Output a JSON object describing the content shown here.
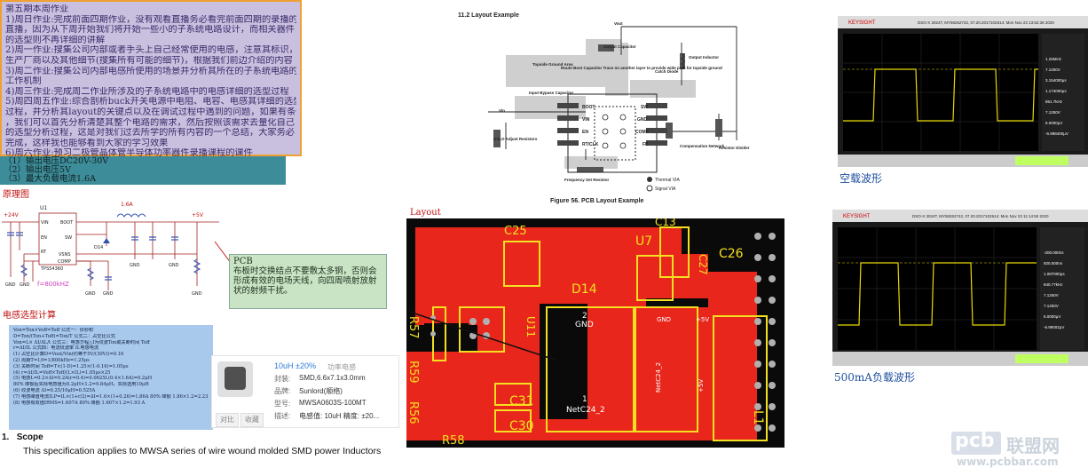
{
  "homework": {
    "lines": [
      "第五期本周作业",
      "1)周日作业:完成前面四期作业，没有观看直播务必看完前面四期的录播的",
      "直播，因为从下周开始我们将开始一些小的子系统电路设计，而相关器件",
      "的选型则不再详细的讲解",
      "2)周一作业:搜集公司内部或者手头上自己经常使用的电感，注意其标识，",
      "生产厂商以及其他细节(搜集所有可能的细节)，根据我们前边介绍的内容",
      "3)周二作业:搜集公司内部电感所使用的场景并分析其所在的子系统电路的",
      "工作机制",
      "4)周三作业:完成周二作业所涉及的子系统电路中的电感详细的选型过程",
      "5)周四周五作业:综合剖析buck开关电源中电阻、电容、电感其详细的选型",
      "过程，并分析其layout的关键点以及在调试过程中遇到的问题，如果有条件",
      "，我们可以首先分析清楚其整个电路的需求，然后按照该需求去量化自己",
      "的选型分析过程，这是对我们过去所学的所有内容的一个总结，大家务必",
      "完成，这样我也能够看到大家的学习效果",
      "6)周六作业:预习二极管晶体管半导体功率器件录播课程的课件"
    ]
  },
  "specs": {
    "lines": [
      "（1）输出电压DC20V-30V",
      "（2）输出电压5V",
      "（3）最大负载电流1.6A"
    ]
  },
  "labels": {
    "schematic_title": "原理图",
    "inductor_calc_title": "电感选型计算",
    "layout_title": "Layout"
  },
  "schematic": {
    "current": "1.6A",
    "vin": "+24V",
    "vout": "+5V",
    "chip": "U1",
    "chip_part": "TPS54360",
    "freq": "f=800kHZ",
    "diode": "D14",
    "pin_vin": "VIN",
    "pin_en": "EN",
    "pin_boot": "BOOT",
    "pin_sw": "SW",
    "pin_rt": "RT",
    "pin_comp": "COMP",
    "pin_vsns": "VSNS",
    "gnd": "GND"
  },
  "pcb_note": {
    "title": "PCB",
    "body": [
      "布板时交换结点不要敷太多铜，否则会",
      "形成有效的电场天线，向四周喷射放射",
      "状的射频干扰。"
    ]
  },
  "formula": {
    "lines": [
      "Von=Ton×Voff=Toff        公式一：伏秒积",
      "D=Ton/(Ton+Toff)=Ton/T    公式二：占空比公式",
      "Von=L× ΔI/ΔL/t             公式三：电感方程△I为纹波Ton或关断时间 Toff",
      "r=ΔI/IL                        公式四：电流纹波率 IL电感电流",
      "(1) 占空比计算D=Vout/Vin(约等于5V/(30V))=0.16",
      "(2) 周期T=1/f=1/800kHz=1.25μs",
      "(3) 关断时间 Toff=T×(1-D)=1.25×(1-0.16)=1.05μs",
      "(4) r=ΔI/IL=Voff×Toff/(L×IL)=1.05μs×25",
      "(5) 电感L=0.2×ΔI=0.2A(r=0.4)=0.0625L(0.4×1.6A)=0.2μH",
      "    80% 降额后实际电感值为8.2μH×1.2=9.84μH，实际选用10μH",
      "(6) 纹波电流 ΔI=0.25/10μH=0.525A",
      "(7) 电感峰值电流ILP=IL×(1+r/2)=ΔI=1.6×(1+0.26)=1.86A    80% 降额 1.86×1.2=2.23 A",
      "(8) 电感有效值IRMS=1.607A    80% 降额 1.607×1.2=1.93 A"
    ]
  },
  "product": {
    "title": "10uH ±20%",
    "tag": "功率电感",
    "rows": [
      {
        "key": "封装:",
        "val": "SMD,6.6x7.1x3.0mm"
      },
      {
        "key": "品牌:",
        "val": "Sunlord(顺络)"
      },
      {
        "key": "型号:",
        "val": "MWSA0603S-100MT"
      },
      {
        "key": "描述:",
        "val": "电感值: 10uH 精度: ±20..."
      }
    ],
    "compare": "对比",
    "favorite": "收藏"
  },
  "scope_section": {
    "number": "1.",
    "title": "Scope",
    "text": "This specification applies to MWSA series of wire wound molded SMD power Inductors"
  },
  "layout_example": {
    "heading": "11.2  Layout Example",
    "caption": "Figure 56.  PCB Layout Example",
    "vout": "Vout",
    "output_capacitor": "Output Capacitor",
    "topside_ground": "Topside Ground Area",
    "route_boot": "Route Boot Capacitor Trace on another layer to provide wide path for topside ground",
    "output_inductor": "Output Inductor",
    "catch_diode": "Catch Diode",
    "input_bypass": "Input Bypass Capacitor",
    "vin": "Vin",
    "uvlo": "UVLO Adjust Resistors",
    "freq_set": "Frequency Set Resistor",
    "compensation": "Compensation Network",
    "resistor_divider": "Resistor Divider",
    "thermal_via": "Thermal VIA",
    "signal_via": "Signal VIA",
    "pins_left": [
      "BOOT",
      "VIN",
      "EN",
      "RT/CLK"
    ],
    "pins_right": [
      "SW",
      "GND",
      "COMP",
      "FB"
    ]
  },
  "pcb": {
    "labels": [
      "C25",
      "C13",
      "C27",
      "C26",
      "U7",
      "D14",
      "U11",
      "R57",
      "R59",
      "R56",
      "R58",
      "C31",
      "C30",
      "L1"
    ],
    "pad_gnd_num": "2",
    "pad_gnd": "GND",
    "pad_net_num": "1",
    "pad_net": "NetC24_2",
    "pad_5v": "+5V"
  },
  "scope1": {
    "brand": "KEYSIGHT",
    "model": "DSO-X 3024T, MY58262742, 07.20.2017102614: Mon Nov 23 13:52:36 2020",
    "caption": "空载波形",
    "readouts": [
      "1.25MHz",
      "7.1250V",
      "3.154000μs",
      "1.174000μs",
      "851.7kHz",
      "7.1250V",
      "6.0000μV",
      "-6.998400μV"
    ]
  },
  "scope2": {
    "brand": "KEYSIGHT",
    "model": "DSO-X 3024T, MY58262742, 07.20.2017102614: Mon Nov 23 11:14:50 2020",
    "caption": "500mA负载波形",
    "readouts": [
      "-200.000ns",
      "920.000ns",
      "1.087000μs",
      "940.77kHz",
      "7.1250V",
      "7.1250V",
      "6.0000μV",
      "-6.99002μV"
    ]
  },
  "watermark": {
    "brand": "pcb",
    "name": "联盟网",
    "url": "www.pcbbar.com"
  },
  "colors": {
    "homework_bg": "#c8c0de",
    "homework_border": "#f0a030",
    "spec_bg": "#3d8c99",
    "pcb_red": "#e8261c",
    "pcb_black": "#0a0a0a",
    "silk_yellow": "#f4e020",
    "scope_trace": "#e8d800"
  }
}
